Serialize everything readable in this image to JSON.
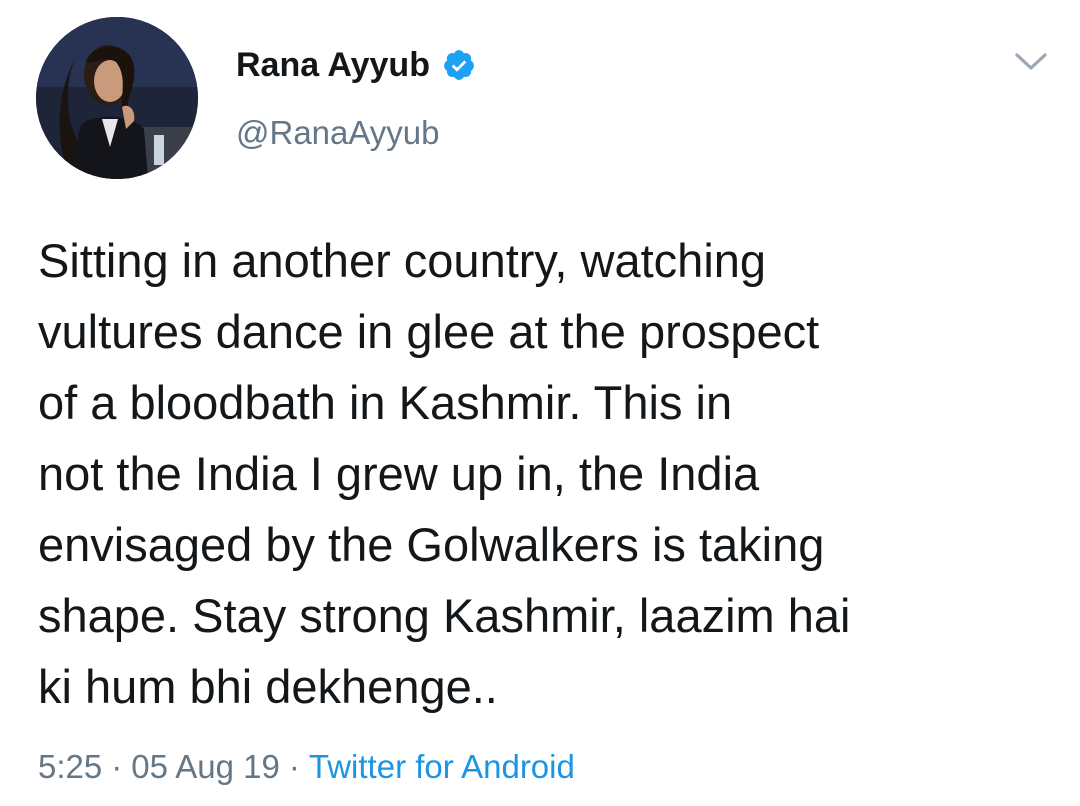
{
  "user": {
    "display_name": "Rana Ayyub",
    "handle": "@RanaAyyub",
    "verified": true,
    "verified_color": "#1da1f2"
  },
  "tweet": {
    "text": "Sitting in another country, watching\nvultures dance in glee at the prospect\nof a bloodbath in Kashmir. This in\nnot the India I grew up in, the India\nenvisaged by the Golwalkers is taking\nshape. Stay strong Kashmir, laazim hai\nki hum bhi dekhenge.."
  },
  "meta": {
    "time": "5:25",
    "separator": "·",
    "date": "05 Aug 19",
    "source": "Twitter for Android",
    "source_color": "#1b95e0"
  },
  "icons": {
    "avatar": "profile-photo",
    "verified": "verified-badge-icon",
    "menu": "chevron-down-icon"
  }
}
